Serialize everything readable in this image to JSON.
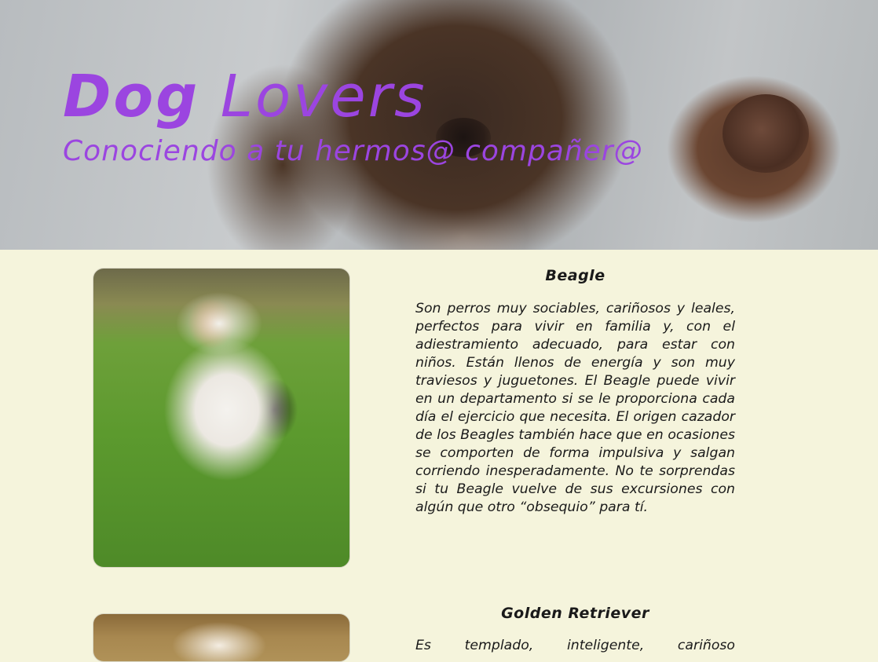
{
  "hero": {
    "title_word1": "Dog",
    "title_word2": "Lovers",
    "subtitle": "Conociendo a tu hermos@ compañer@"
  },
  "breeds": [
    {
      "name": "Beagle",
      "description": "Son perros muy sociables, cariñosos y leales, perfectos para vivir en familia y, con el adiestramiento adecuado, para estar con niños. Están llenos de energía y son muy traviesos y juguetones. El Beagle puede vivir en un departamento si se le proporciona cada día el ejercicio que necesita. El origen cazador de los Beagles también hace que en ocasiones se comporten de forma impulsiva y salgan corriendo inesperadamente. No te sorprendas si tu Beagle vuelve de sus excursiones con algún que otro “obsequio” para tí."
    },
    {
      "name": "Golden Retriever",
      "description": "Es templado, inteligente, cariñoso"
    }
  ],
  "colors": {
    "accent": "#9b45e0",
    "page_background": "#f5f4dc",
    "text": "#1a1a1a"
  }
}
